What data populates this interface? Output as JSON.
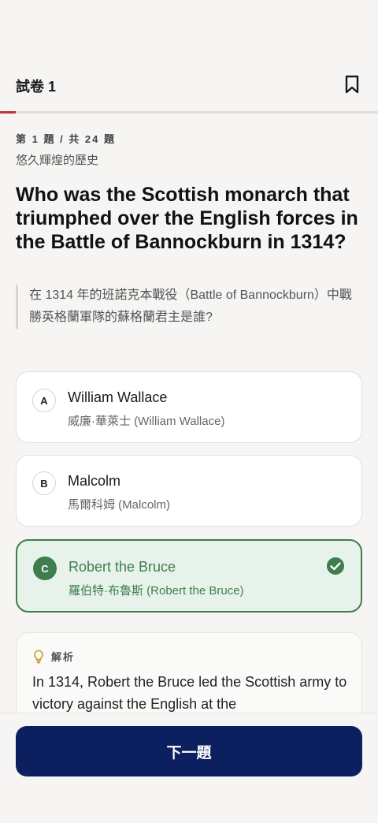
{
  "header": {
    "title": "試卷 1"
  },
  "progress": {
    "current": 1,
    "total": 24,
    "fraction": 0.0417
  },
  "question": {
    "counter": "第 1 題 / 共 24 題",
    "category": "悠久輝煌的歷史",
    "text": "Who was the Scottish monarch that triumphed over the English forces in the Battle of Bannockburn in 1314?",
    "translation": "在 1314 年的班諾克本戰役（Battle of Bannockburn）中戰勝英格蘭軍隊的蘇格蘭君主是誰?"
  },
  "options": [
    {
      "letter": "A",
      "main": "William Wallace",
      "sub": "威廉·華萊士 (William Wallace)",
      "state": "default"
    },
    {
      "letter": "B",
      "main": "Malcolm",
      "sub": "馬爾科姆 (Malcolm)",
      "state": "default"
    },
    {
      "letter": "C",
      "main": "Robert the Bruce",
      "sub": "羅伯特·布魯斯 (Robert the Bruce)",
      "state": "correct"
    }
  ],
  "explanation": {
    "label": "解析",
    "text": "In 1314, Robert the Bruce led the Scottish army to victory against the English at the"
  },
  "next_button": {
    "label": "下一題"
  },
  "colors": {
    "accent_progress": "#c0343b",
    "correct_green": "#3e7d4e",
    "correct_bg": "#e7f3ea",
    "primary_button": "#0c1f5e"
  },
  "icons": {
    "bookmark": "bookmark-icon",
    "check": "check-circle-icon",
    "lightbulb": "lightbulb-icon"
  }
}
